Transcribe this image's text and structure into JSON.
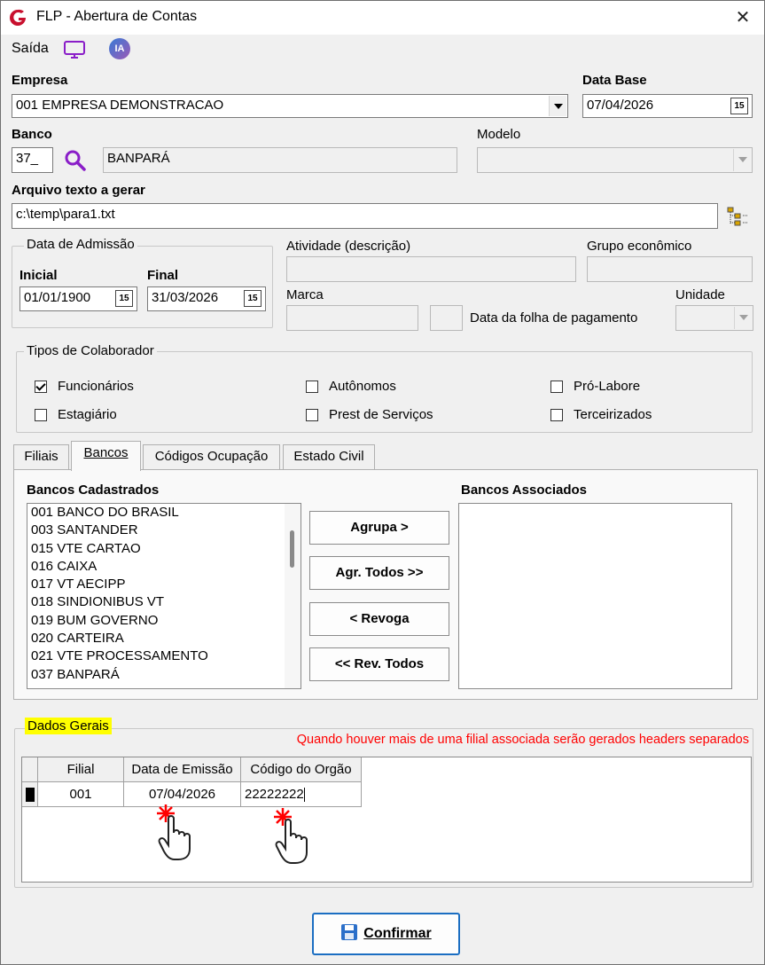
{
  "window": {
    "title": "FLP - Abertura de Contas"
  },
  "toolbar": {
    "saida_label": "Saída",
    "ia_label": "IA"
  },
  "empresa": {
    "label": "Empresa",
    "value": "001 EMPRESA DEMONSTRACAO"
  },
  "data_base": {
    "label": "Data Base",
    "value": "07/04/2026"
  },
  "banco": {
    "label": "Banco",
    "code": "37_",
    "name": "BANPARÁ"
  },
  "modelo": {
    "label": "Modelo",
    "value": ""
  },
  "arquivo": {
    "label": "Arquivo texto a gerar",
    "value": "c:\\temp\\para1.txt"
  },
  "admissao": {
    "legend": "Data de Admissão",
    "inicial_label": "Inicial",
    "inicial_value": "01/01/1900",
    "final_label": "Final",
    "final_value": "31/03/2026"
  },
  "atividade": {
    "label": "Atividade (descrição)",
    "value": ""
  },
  "grupo": {
    "label": "Grupo econômico",
    "value": ""
  },
  "marca": {
    "label": "Marca",
    "value": ""
  },
  "data_folha": {
    "label": "Data da folha de pagamento",
    "value": ""
  },
  "unidade": {
    "label": "Unidade",
    "value": ""
  },
  "tipos": {
    "legend": "Tipos de Colaborador",
    "items": [
      {
        "label": "Funcionários",
        "checked": true
      },
      {
        "label": "Estagiário",
        "checked": false
      },
      {
        "label": "Autônomos",
        "checked": false
      },
      {
        "label": "Prest de Serviços",
        "checked": false
      },
      {
        "label": "Pró-Labore",
        "checked": false
      },
      {
        "label": "Terceirizados",
        "checked": false
      }
    ]
  },
  "tabs": [
    {
      "label": "Filiais",
      "active": false
    },
    {
      "label": "Bancos",
      "active": true
    },
    {
      "label": "Códigos Ocupação",
      "active": false
    },
    {
      "label": "Estado Civil",
      "active": false
    }
  ],
  "bancos": {
    "cadastrados_label": "Bancos Cadastrados",
    "associados_label": "Bancos Associados",
    "cadastrados": [
      "001 BANCO DO BRASIL",
      "003 SANTANDER",
      "015 VTE CARTAO",
      "016 CAIXA",
      "017 VT AECIPP",
      "018 SINDIONIBUS VT",
      "019 BUM GOVERNO",
      "020 CARTEIRA",
      "021 VTE PROCESSAMENTO",
      "037 BANPARÁ"
    ],
    "associados": [],
    "buttons": {
      "agrupa": "Agrupa >",
      "agr_todos": "Agr. Todos >>",
      "revoga": "< Revoga",
      "rev_todos": "<< Rev. Todos"
    }
  },
  "dados_gerais": {
    "legend": "Dados Gerais",
    "warning": "Quando houver mais de uma filial associada serão gerados headers separados",
    "columns": [
      "Filial",
      "Data de Emissão",
      "Código do Orgão"
    ],
    "rows": [
      [
        "001",
        "07/04/2026",
        "22222222"
      ]
    ]
  },
  "confirmar_label": "Confirmar",
  "colors": {
    "highlight": "#ffff00",
    "warning": "#ff0000",
    "accent": "#8a1ec8"
  }
}
